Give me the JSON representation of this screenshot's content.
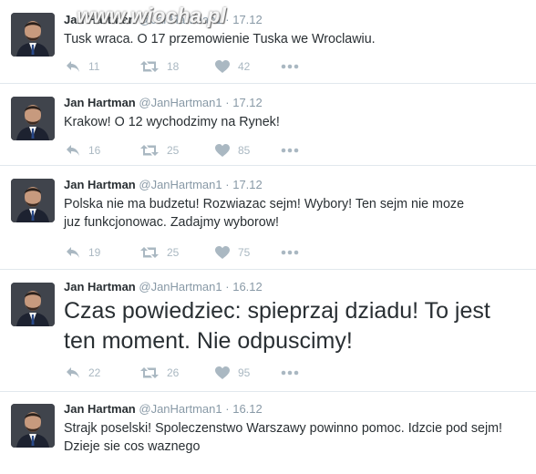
{
  "watermark": "www.wiocha.pl",
  "tweets": [
    {
      "name": "Jan Hartman",
      "handle": "@JanHartman1",
      "separator": "·",
      "date": "17.12",
      "text": "Tusk wraca. O 17 przemowienie Tuska we Wroclawiu.",
      "size": "normal",
      "replies": "11",
      "retweets": "18",
      "likes": "42"
    },
    {
      "name": "Jan Hartman",
      "handle": "@JanHartman1",
      "separator": "·",
      "date": "17.12",
      "text": "Krakow! O 12 wychodzimy na Rynek!",
      "size": "normal",
      "replies": "16",
      "retweets": "25",
      "likes": "85"
    },
    {
      "name": "Jan Hartman",
      "handle": "@JanHartman1",
      "separator": "·",
      "date": "17.12",
      "text": "Polska nie ma budzetu! Rozwiazac sejm! Wybory! Ten sejm nie moze juz funkcjonowac. Zadajmy wyborow!",
      "size": "normal",
      "replies": "19",
      "retweets": "25",
      "likes": "75"
    },
    {
      "name": "Jan Hartman",
      "handle": "@JanHartman1",
      "separator": "·",
      "date": "16.12",
      "text": "Czas powiedziec: spieprzaj dziadu! To jest ten moment. Nie odpuscimy!",
      "size": "large",
      "replies": "22",
      "retweets": "26",
      "likes": "95"
    },
    {
      "name": "Jan Hartman",
      "handle": "@JanHartman1",
      "separator": "·",
      "date": "16.12",
      "text": "Strajk poselski! Spoleczenstwo Warszawy powinno pomoc. Idzcie pod sejm! Dzieje sie cos waznego",
      "size": "normal",
      "replies": "",
      "retweets": "",
      "likes": ""
    }
  ],
  "icons": {
    "reply": "reply-icon",
    "retweet": "retweet-icon",
    "like": "heart-icon",
    "more": "more-dots-icon"
  },
  "colors": {
    "icon": "#aab8c2",
    "meta": "#8899a6",
    "text": "#292f33",
    "divider": "#e1e8ed"
  }
}
